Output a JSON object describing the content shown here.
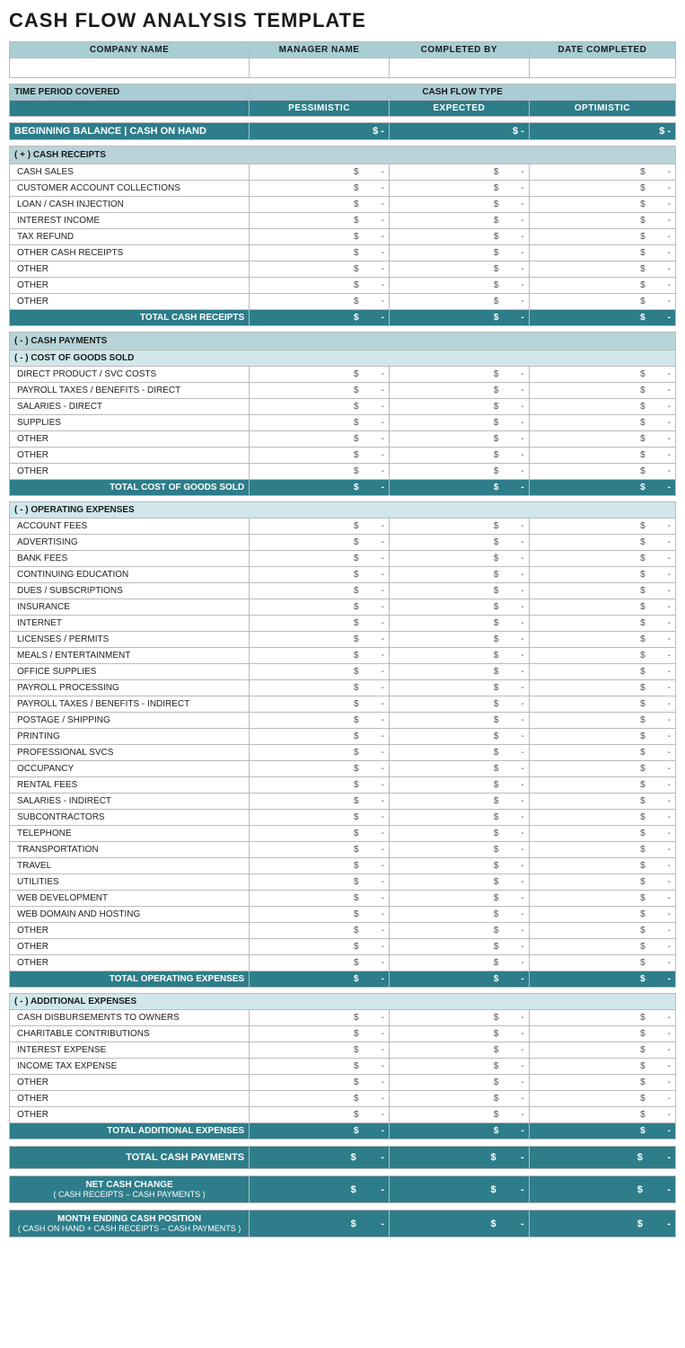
{
  "title": "CASH FLOW ANALYSIS TEMPLATE",
  "header": {
    "columns": [
      "COMPANY NAME",
      "MANAGER NAME",
      "COMPLETED BY",
      "DATE COMPLETED"
    ]
  },
  "time_period": {
    "label": "TIME PERIOD COVERED",
    "cash_flow_type": "CASH FLOW TYPE",
    "pessimistic": "PESSIMISTIC",
    "expected": "EXPECTED",
    "optimistic": "OPTIMISTIC"
  },
  "beginning_balance": {
    "label": "BEGINNING BALANCE | CASH ON HAND",
    "values": [
      "-",
      "-",
      "-"
    ]
  },
  "cash_receipts": {
    "section_label": "( + )  CASH RECEIPTS",
    "items": [
      "CASH SALES",
      "CUSTOMER ACCOUNT COLLECTIONS",
      "LOAN / CASH INJECTION",
      "INTEREST INCOME",
      "TAX REFUND",
      "OTHER CASH RECEIPTS",
      "OTHER",
      "OTHER",
      "OTHER"
    ],
    "total_label": "TOTAL CASH RECEIPTS",
    "total_values": [
      "-",
      "-",
      "-"
    ]
  },
  "cash_payments": {
    "section_label": "( - )  CASH PAYMENTS",
    "cost_of_goods": {
      "sub_label": "( - )  COST OF GOODS SOLD",
      "items": [
        "DIRECT PRODUCT / SVC COSTS",
        "PAYROLL TAXES / BENEFITS - DIRECT",
        "SALARIES - DIRECT",
        "SUPPLIES",
        "OTHER",
        "OTHER",
        "OTHER"
      ],
      "total_label": "TOTAL COST OF GOODS SOLD",
      "total_values": [
        "-",
        "-",
        "-"
      ]
    },
    "operating_expenses": {
      "sub_label": "( - )  OPERATING EXPENSES",
      "items": [
        "ACCOUNT FEES",
        "ADVERTISING",
        "BANK FEES",
        "CONTINUING EDUCATION",
        "DUES / SUBSCRIPTIONS",
        "INSURANCE",
        "INTERNET",
        "LICENSES / PERMITS",
        "MEALS / ENTERTAINMENT",
        "OFFICE SUPPLIES",
        "PAYROLL PROCESSING",
        "PAYROLL TAXES / BENEFITS - INDIRECT",
        "POSTAGE / SHIPPING",
        "PRINTING",
        "PROFESSIONAL SVCS",
        "OCCUPANCY",
        "RENTAL FEES",
        "SALARIES - INDIRECT",
        "SUBCONTRACTORS",
        "TELEPHONE",
        "TRANSPORTATION",
        "TRAVEL",
        "UTILITIES",
        "WEB DEVELOPMENT",
        "WEB DOMAIN AND HOSTING",
        "OTHER",
        "OTHER",
        "OTHER"
      ],
      "total_label": "TOTAL OPERATING EXPENSES",
      "total_values": [
        "-",
        "-",
        "-"
      ]
    },
    "additional_expenses": {
      "sub_label": "( - )  ADDITIONAL EXPENSES",
      "items": [
        "CASH DISBURSEMENTS TO OWNERS",
        "CHARITABLE CONTRIBUTIONS",
        "INTEREST EXPENSE",
        "INCOME TAX EXPENSE",
        "OTHER",
        "OTHER",
        "OTHER"
      ],
      "total_label": "TOTAL ADDITIONAL EXPENSES",
      "total_values": [
        "-",
        "-",
        "-"
      ]
    }
  },
  "total_cash_payments": {
    "label": "TOTAL CASH PAYMENTS",
    "values": [
      "-",
      "-",
      "-"
    ]
  },
  "net_cash_change": {
    "label": "NET CASH CHANGE",
    "sub_label": "( CASH RECEIPTS – CASH PAYMENTS )",
    "values": [
      "-",
      "-",
      "-"
    ]
  },
  "month_ending": {
    "label": "MONTH ENDING CASH POSITION",
    "sub_label": "( CASH ON HAND + CASH RECEIPTS – CASH PAYMENTS )",
    "values": [
      "-",
      "-",
      "-"
    ]
  },
  "colors": {
    "teal_dark": "#2d7d8a",
    "teal_light": "#a8cdd4",
    "teal_mid": "#b8d4d8",
    "section_bg": "#d0e8eb"
  }
}
